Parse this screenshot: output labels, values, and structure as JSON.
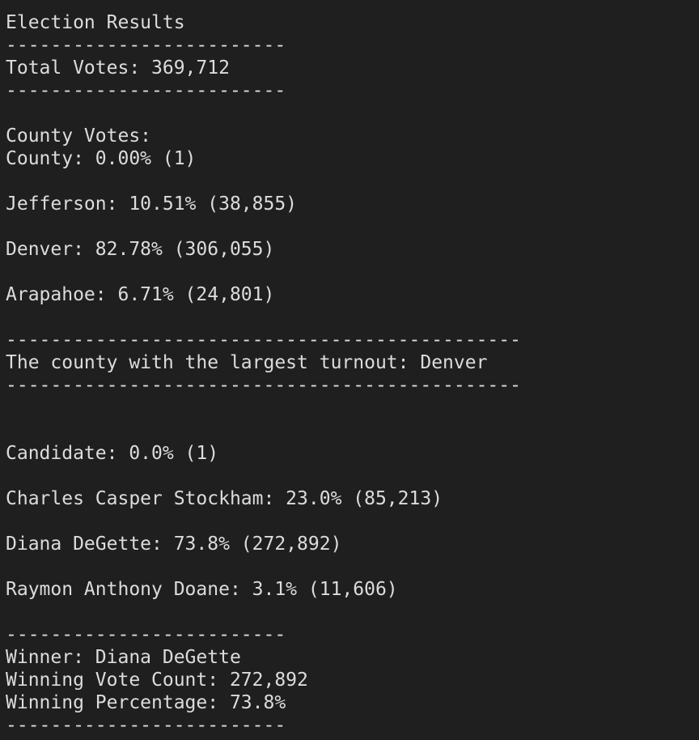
{
  "terminal": {
    "lines": [
      "Election Results",
      "-------------------------",
      "Total Votes: 369,712",
      "-------------------------",
      "",
      "County Votes:",
      "County: 0.00% (1)",
      "",
      "Jefferson: 10.51% (38,855)",
      "",
      "Denver: 82.78% (306,055)",
      "",
      "Arapahoe: 6.71% (24,801)",
      "",
      "----------------------------------------------",
      "The county with the largest turnout: Denver",
      "----------------------------------------------",
      "",
      "",
      "Candidate: 0.0% (1)",
      "",
      "Charles Casper Stockham: 23.0% (85,213)",
      "",
      "Diana DeGette: 73.8% (272,892)",
      "",
      "Raymon Anthony Doane: 3.1% (11,606)",
      "",
      "-------------------------",
      "Winner: Diana DeGette",
      "Winning Vote Count: 272,892",
      "Winning Percentage: 73.8%",
      "-------------------------"
    ]
  }
}
